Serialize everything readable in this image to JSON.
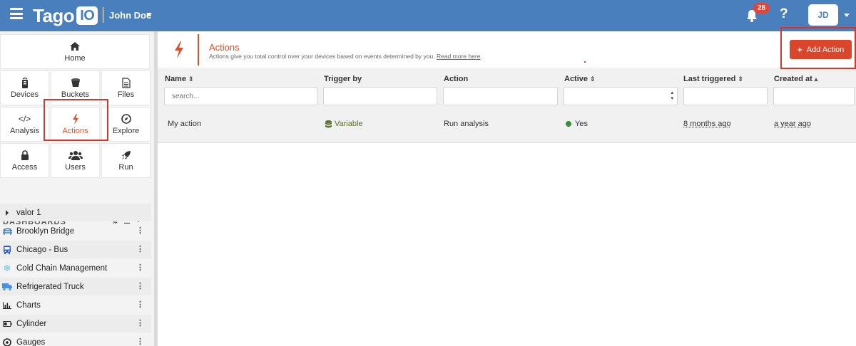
{
  "topbar": {
    "logo_text": "Tago",
    "logo_io": "IO",
    "user_name": "John Doe",
    "notifications_count": "28",
    "help_label": "?",
    "avatar_initials": "JD"
  },
  "sidebar": {
    "tiles": {
      "home": "Home",
      "devices": "Devices",
      "buckets": "Buckets",
      "files": "Files",
      "analysis": "Analysis",
      "actions": "Actions",
      "explore": "Explore",
      "access": "Access",
      "users": "Users",
      "run": "Run"
    },
    "dashboards_header": "DASHBOARDS",
    "dashboards": [
      {
        "label": "valor 1",
        "icon": "caret-right-icon"
      },
      {
        "label": "Brooklyn Bridge",
        "icon": "bridge-icon"
      },
      {
        "label": "Chicago - Bus",
        "icon": "bus-icon"
      },
      {
        "label": "Cold Chain Management",
        "icon": "snowflake-icon"
      },
      {
        "label": "Refrigerated Truck",
        "icon": "truck-icon"
      },
      {
        "label": "Charts",
        "icon": "bar-chart-icon"
      },
      {
        "label": "Cylinder",
        "icon": "battery-icon"
      },
      {
        "label": "Gauges",
        "icon": "gauge-icon"
      }
    ]
  },
  "page": {
    "title": "Actions",
    "description": "Actions give you total control over your devices based on events determined by you.",
    "read_more": "Read more here",
    "add_button": "Add Action"
  },
  "table": {
    "columns": {
      "name": "Name",
      "trigger": "Trigger by",
      "action": "Action",
      "active": "Active",
      "last_triggered": "Last triggered",
      "created_at": "Created at"
    },
    "search_placeholder": "search...",
    "rows": [
      {
        "name": "My action",
        "trigger": "Variable",
        "action": "Run analysis",
        "active": "Yes",
        "last_triggered": "8 months ago",
        "created_at": "a year ago"
      }
    ]
  },
  "colors": {
    "topbar": "#4a7fbd",
    "accent": "#e04f27",
    "button": "#d9462b",
    "active_green": "#3a8d3a"
  }
}
